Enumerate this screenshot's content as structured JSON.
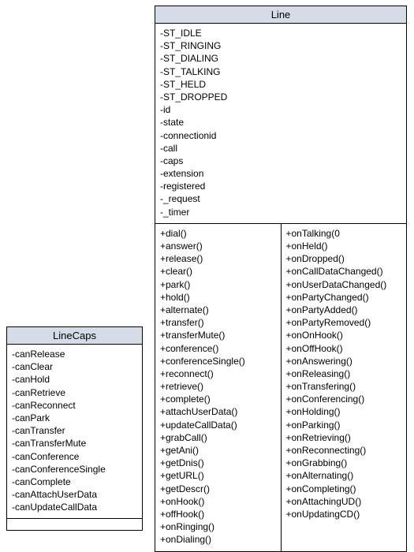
{
  "classes": {
    "linecaps": {
      "title": "LineCaps",
      "attributes": [
        "-canRelease",
        "-canClear",
        "-canHold",
        "-canRetrieve",
        "-canReconnect",
        "-canPark",
        "-canTransfer",
        "-canTransferMute",
        "-canConference",
        "-canConferenceSingle",
        "-canComplete",
        "-canAttachUserData",
        "-canUpdateCallData"
      ],
      "methods_col1": [],
      "methods_col2": []
    },
    "line": {
      "title": "Line",
      "attributes": [
        "-ST_IDLE",
        "-ST_RINGING",
        "-ST_DIALING",
        "-ST_TALKING",
        "-ST_HELD",
        "-ST_DROPPED",
        "-id",
        "-state",
        "-connectionid",
        "-call",
        "-caps",
        "-extension",
        "-registered",
        "-_request",
        "-_timer"
      ],
      "methods_col1": [
        "+dial()",
        "+answer()",
        "+release()",
        "+clear()",
        "+park()",
        "+hold()",
        "+alternate()",
        "+transfer()",
        "+transferMute()",
        "+conference()",
        "+conferenceSingle()",
        "+reconnect()",
        "+retrieve()",
        "+complete()",
        "+attachUserData()",
        "+updateCallData()",
        "+grabCall()",
        "+getAni()",
        "+getDnis()",
        "+getURL()",
        "+getDescr()",
        "+onHook()",
        "+offHook()",
        "+onRinging()",
        "+onDialing()"
      ],
      "methods_col2": [
        "+onTalking(0",
        "+onHeld()",
        "+onDropped()",
        "+onCallDataChanged()",
        "+onUserDataChanged()",
        "+onPartyChanged()",
        "+onPartyAdded()",
        "+onPartyRemoved()",
        "+onOnHook()",
        "+onOffHook()",
        "+onAnswering()",
        "+onReleasing()",
        "+onTransfering()",
        "+onConferencing()",
        "+onHolding()",
        "+onParking()",
        "+onRetrieving()",
        "+onReconnecting()",
        "+onGrabbing()",
        "+onAlternating()",
        "+onCompleting()",
        "+onAttachingUD()",
        "+onUpdatingCD()"
      ]
    }
  }
}
